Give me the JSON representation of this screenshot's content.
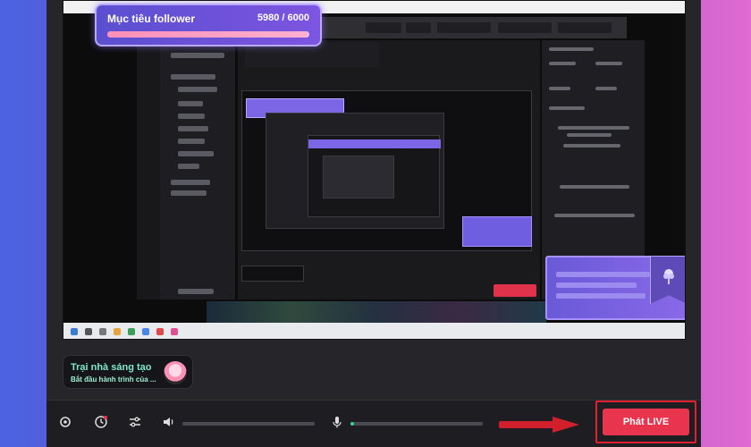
{
  "follower_goal": {
    "title": "Mục tiêu follower",
    "current": 5980,
    "target": 6000,
    "count_label": "5980 / 6000",
    "progress": 0.9967
  },
  "creator_card": {
    "title": "Trại nhà sáng tạo",
    "subtitle": "Bắt đầu hành trình của ..."
  },
  "controls": {
    "settings_icon": "gear-icon",
    "clock_icon": "clock-badge-icon",
    "mixer_icon": "sliders-icon",
    "speaker_icon": "speaker-icon",
    "mic_icon": "microphone-icon",
    "speaker_level": 0.0,
    "mic_level": 0.03,
    "go_live_label": "Phát LIVE"
  },
  "colors": {
    "accent_red": "#e8354d",
    "highlight_red": "#e02030",
    "mic_green": "#3ad08a"
  }
}
